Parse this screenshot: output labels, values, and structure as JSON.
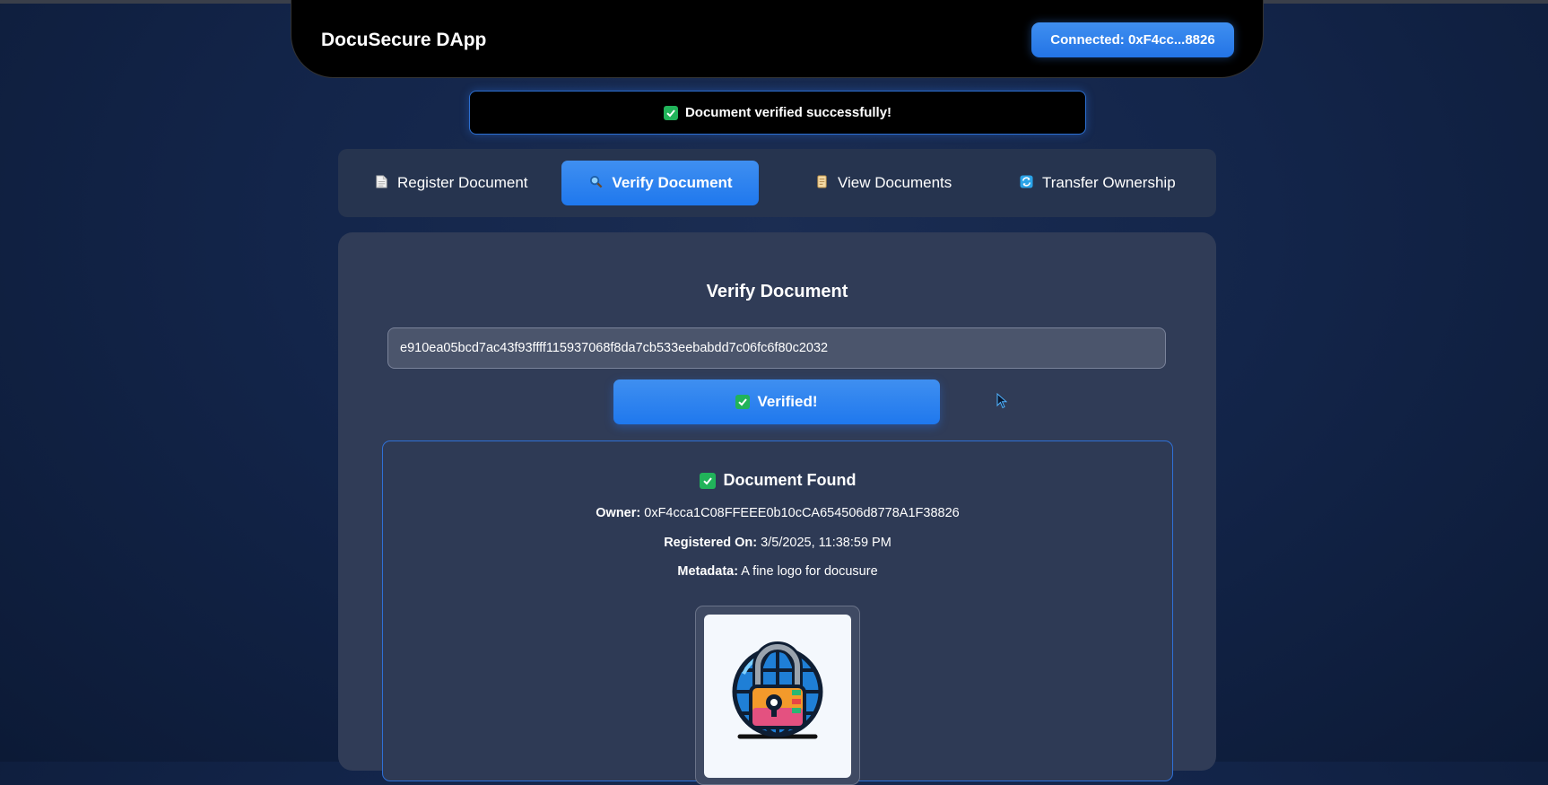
{
  "header": {
    "app_title": "DocuSecure DApp",
    "wallet_label": "Connected: 0xF4cc...8826"
  },
  "toast": {
    "message": "Document verified successfully!",
    "icon": "check-icon"
  },
  "tabs": [
    {
      "label": "Register Document",
      "icon": "document-icon",
      "active": false
    },
    {
      "label": "Verify Document",
      "icon": "magnifier-icon",
      "active": true
    },
    {
      "label": "View Documents",
      "icon": "scroll-icon",
      "active": false
    },
    {
      "label": "Transfer Ownership",
      "icon": "refresh-icon",
      "active": false
    }
  ],
  "verify": {
    "title": "Verify Document",
    "hash_value": "e910ea05bcd7ac43f93ffff115937068f8da7cb533eebabdd7c06fc6f80c2032",
    "button_label": "Verified!"
  },
  "result": {
    "title": "Document Found",
    "owner_label": "Owner:",
    "owner_value": "0xF4cca1C08FFEEE0b10cCA654506d8778A1F38826",
    "registered_label": "Registered On:",
    "registered_value": "3/5/2025, 11:38:59 PM",
    "metadata_label": "Metadata:",
    "metadata_value": "A fine logo for docusure"
  },
  "colors": {
    "accent": "#2f86ef",
    "success": "#21b35a",
    "background": "#13254a",
    "panel": "#303c57"
  }
}
